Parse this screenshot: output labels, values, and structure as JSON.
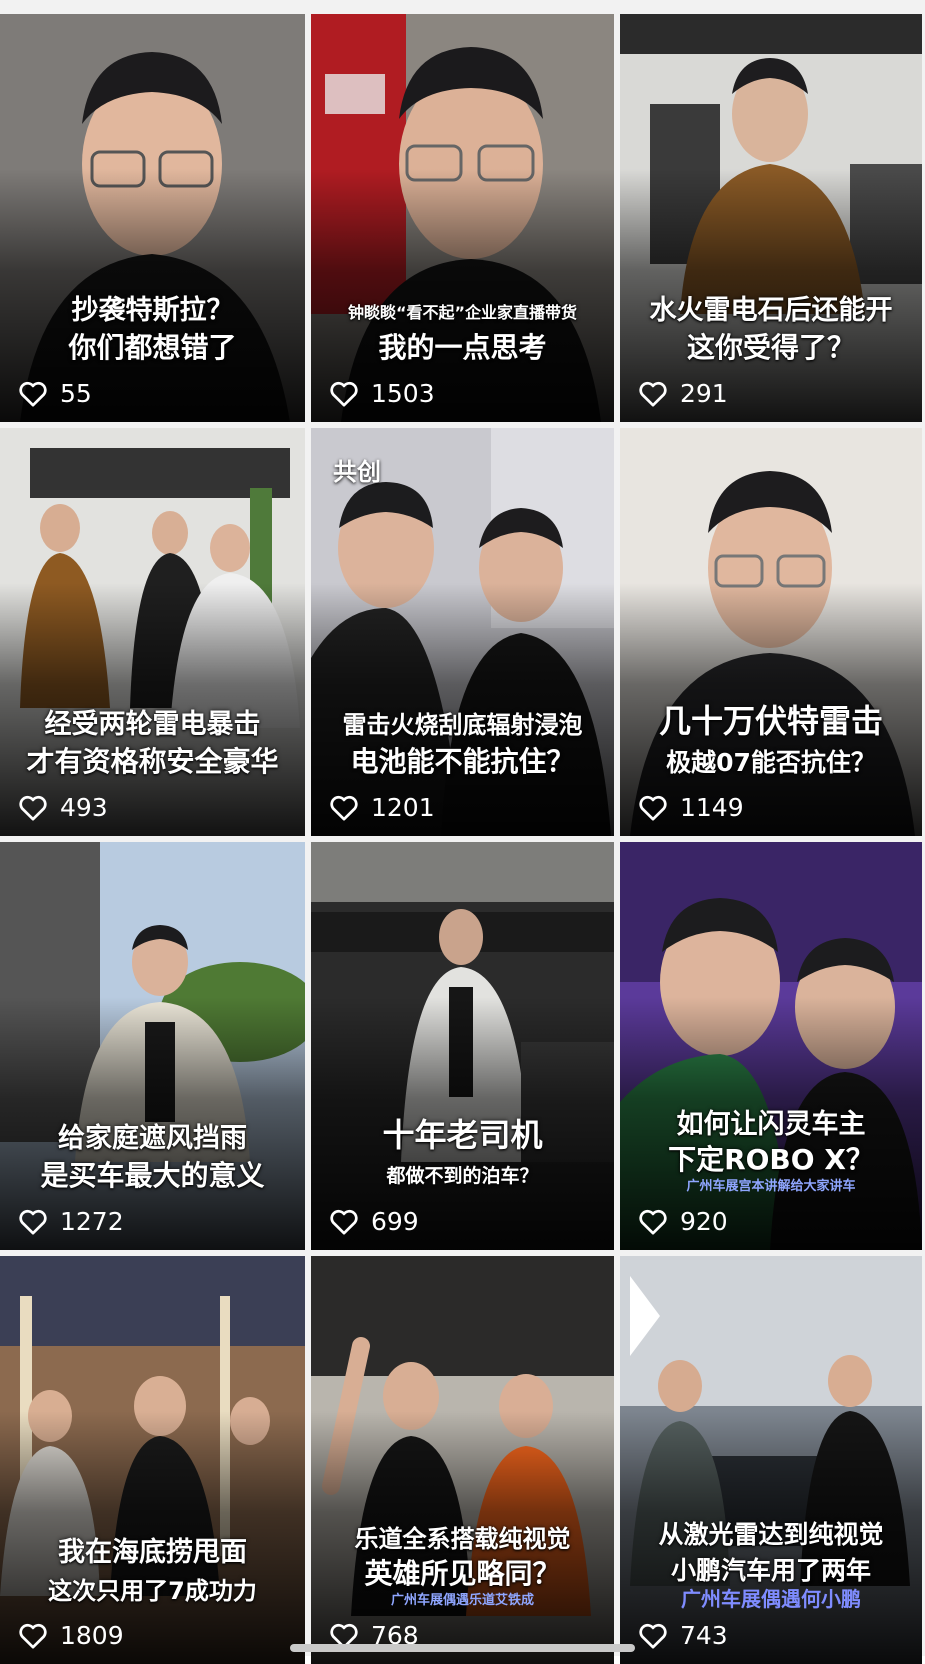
{
  "videos": [
    {
      "caption1": "抄袭特斯拉？",
      "caption2": "你们都想错了",
      "likes": "55"
    },
    {
      "caption1": "钟睒睒“看不起”企业家直播带货",
      "caption2": "我的一点思考",
      "likes": "1503"
    },
    {
      "caption1": "水火雷电石后还能开",
      "caption2": "这你受得了？",
      "likes": "291"
    },
    {
      "caption1": "经受两轮雷电暴击",
      "caption2": "才有资格称安全豪华",
      "likes": "493"
    },
    {
      "badge": "共创",
      "caption1": "雷击火烧刮底辐射浸泡",
      "caption2": "电池能不能抗住？",
      "likes": "1201"
    },
    {
      "caption1": "几十万伏特雷击",
      "caption2": "极越07能否抗住？",
      "likes": "1149"
    },
    {
      "caption1": "给家庭遮风挡雨",
      "caption2": "是买车最大的意义",
      "likes": "1272"
    },
    {
      "caption1": "十年老司机",
      "caption2": "都做不到的泊车？",
      "likes": "699"
    },
    {
      "caption1": "如何让闪灵车主",
      "caption2": "下定ROBO X？",
      "caption3": "广州车展宫本讲解给大家讲车",
      "likes": "920"
    },
    {
      "caption1": "我在海底捞甩面",
      "caption2": "这次只用了7成功力",
      "likes": "1809"
    },
    {
      "caption1": "乐道全系搭载纯视觉",
      "caption2": "英雄所见略同？",
      "caption3": "广州车展偶遇乐道艾铁成",
      "likes": "768"
    },
    {
      "caption1": "从激光雷达到纯视觉",
      "caption2": "小鹏汽车用了两年",
      "caption3": "广州车展偶遇何小鹏",
      "likes": "743"
    }
  ]
}
